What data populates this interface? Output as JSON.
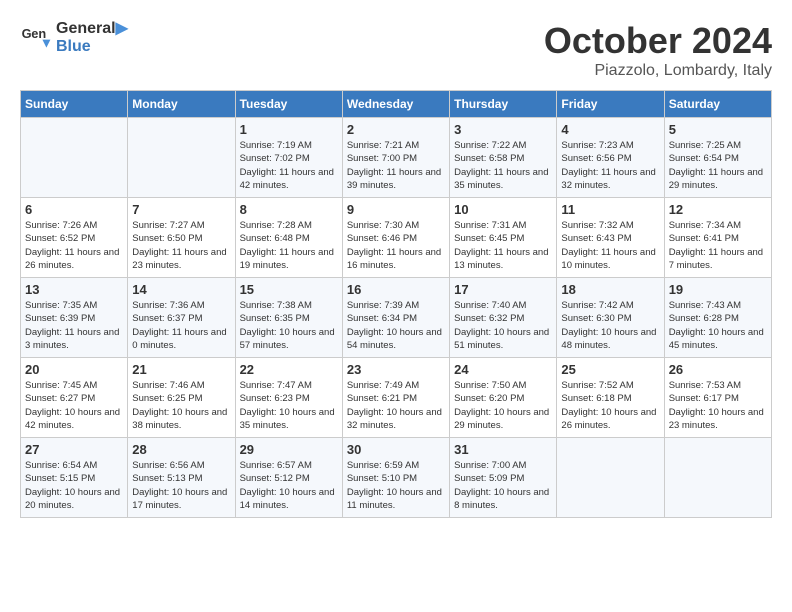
{
  "header": {
    "logo_line1": "General",
    "logo_line2": "Blue",
    "month": "October 2024",
    "location": "Piazzolo, Lombardy, Italy"
  },
  "days_of_week": [
    "Sunday",
    "Monday",
    "Tuesday",
    "Wednesday",
    "Thursday",
    "Friday",
    "Saturday"
  ],
  "weeks": [
    [
      {
        "day": "",
        "info": ""
      },
      {
        "day": "",
        "info": ""
      },
      {
        "day": "1",
        "info": "Sunrise: 7:19 AM\nSunset: 7:02 PM\nDaylight: 11 hours and 42 minutes."
      },
      {
        "day": "2",
        "info": "Sunrise: 7:21 AM\nSunset: 7:00 PM\nDaylight: 11 hours and 39 minutes."
      },
      {
        "day": "3",
        "info": "Sunrise: 7:22 AM\nSunset: 6:58 PM\nDaylight: 11 hours and 35 minutes."
      },
      {
        "day": "4",
        "info": "Sunrise: 7:23 AM\nSunset: 6:56 PM\nDaylight: 11 hours and 32 minutes."
      },
      {
        "day": "5",
        "info": "Sunrise: 7:25 AM\nSunset: 6:54 PM\nDaylight: 11 hours and 29 minutes."
      }
    ],
    [
      {
        "day": "6",
        "info": "Sunrise: 7:26 AM\nSunset: 6:52 PM\nDaylight: 11 hours and 26 minutes."
      },
      {
        "day": "7",
        "info": "Sunrise: 7:27 AM\nSunset: 6:50 PM\nDaylight: 11 hours and 23 minutes."
      },
      {
        "day": "8",
        "info": "Sunrise: 7:28 AM\nSunset: 6:48 PM\nDaylight: 11 hours and 19 minutes."
      },
      {
        "day": "9",
        "info": "Sunrise: 7:30 AM\nSunset: 6:46 PM\nDaylight: 11 hours and 16 minutes."
      },
      {
        "day": "10",
        "info": "Sunrise: 7:31 AM\nSunset: 6:45 PM\nDaylight: 11 hours and 13 minutes."
      },
      {
        "day": "11",
        "info": "Sunrise: 7:32 AM\nSunset: 6:43 PM\nDaylight: 11 hours and 10 minutes."
      },
      {
        "day": "12",
        "info": "Sunrise: 7:34 AM\nSunset: 6:41 PM\nDaylight: 11 hours and 7 minutes."
      }
    ],
    [
      {
        "day": "13",
        "info": "Sunrise: 7:35 AM\nSunset: 6:39 PM\nDaylight: 11 hours and 3 minutes."
      },
      {
        "day": "14",
        "info": "Sunrise: 7:36 AM\nSunset: 6:37 PM\nDaylight: 11 hours and 0 minutes."
      },
      {
        "day": "15",
        "info": "Sunrise: 7:38 AM\nSunset: 6:35 PM\nDaylight: 10 hours and 57 minutes."
      },
      {
        "day": "16",
        "info": "Sunrise: 7:39 AM\nSunset: 6:34 PM\nDaylight: 10 hours and 54 minutes."
      },
      {
        "day": "17",
        "info": "Sunrise: 7:40 AM\nSunset: 6:32 PM\nDaylight: 10 hours and 51 minutes."
      },
      {
        "day": "18",
        "info": "Sunrise: 7:42 AM\nSunset: 6:30 PM\nDaylight: 10 hours and 48 minutes."
      },
      {
        "day": "19",
        "info": "Sunrise: 7:43 AM\nSunset: 6:28 PM\nDaylight: 10 hours and 45 minutes."
      }
    ],
    [
      {
        "day": "20",
        "info": "Sunrise: 7:45 AM\nSunset: 6:27 PM\nDaylight: 10 hours and 42 minutes."
      },
      {
        "day": "21",
        "info": "Sunrise: 7:46 AM\nSunset: 6:25 PM\nDaylight: 10 hours and 38 minutes."
      },
      {
        "day": "22",
        "info": "Sunrise: 7:47 AM\nSunset: 6:23 PM\nDaylight: 10 hours and 35 minutes."
      },
      {
        "day": "23",
        "info": "Sunrise: 7:49 AM\nSunset: 6:21 PM\nDaylight: 10 hours and 32 minutes."
      },
      {
        "day": "24",
        "info": "Sunrise: 7:50 AM\nSunset: 6:20 PM\nDaylight: 10 hours and 29 minutes."
      },
      {
        "day": "25",
        "info": "Sunrise: 7:52 AM\nSunset: 6:18 PM\nDaylight: 10 hours and 26 minutes."
      },
      {
        "day": "26",
        "info": "Sunrise: 7:53 AM\nSunset: 6:17 PM\nDaylight: 10 hours and 23 minutes."
      }
    ],
    [
      {
        "day": "27",
        "info": "Sunrise: 6:54 AM\nSunset: 5:15 PM\nDaylight: 10 hours and 20 minutes."
      },
      {
        "day": "28",
        "info": "Sunrise: 6:56 AM\nSunset: 5:13 PM\nDaylight: 10 hours and 17 minutes."
      },
      {
        "day": "29",
        "info": "Sunrise: 6:57 AM\nSunset: 5:12 PM\nDaylight: 10 hours and 14 minutes."
      },
      {
        "day": "30",
        "info": "Sunrise: 6:59 AM\nSunset: 5:10 PM\nDaylight: 10 hours and 11 minutes."
      },
      {
        "day": "31",
        "info": "Sunrise: 7:00 AM\nSunset: 5:09 PM\nDaylight: 10 hours and 8 minutes."
      },
      {
        "day": "",
        "info": ""
      },
      {
        "day": "",
        "info": ""
      }
    ]
  ]
}
